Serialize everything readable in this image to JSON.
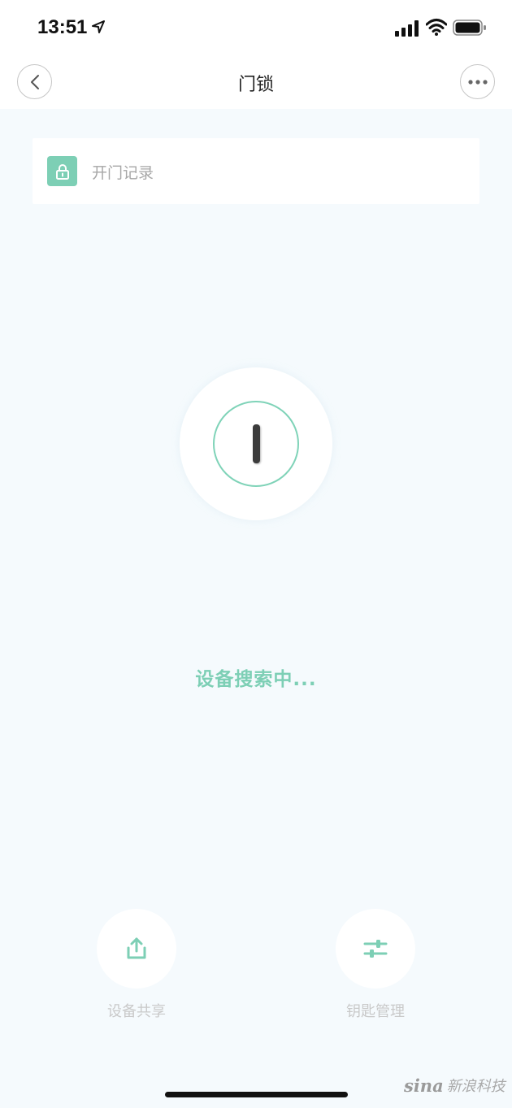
{
  "status_bar": {
    "time": "13:51",
    "icons": [
      "location-arrow-icon",
      "signal-icon",
      "wifi-icon",
      "battery-icon"
    ]
  },
  "nav": {
    "title": "门锁",
    "back_icon": "chevron-left-icon",
    "more_icon": "ellipsis-icon"
  },
  "record_card": {
    "icon": "lock-icon",
    "label": "开门记录"
  },
  "search": {
    "status": "设备搜索中..."
  },
  "actions": [
    {
      "icon": "share-icon",
      "label": "设备共享"
    },
    {
      "icon": "sliders-icon",
      "label": "钥匙管理"
    }
  ],
  "watermark": {
    "logo": "sina",
    "text": "新浪科技"
  },
  "colors": {
    "accent": "#7dcfb5",
    "background": "#f5fafd",
    "label_gray": "#c9c9c9"
  }
}
